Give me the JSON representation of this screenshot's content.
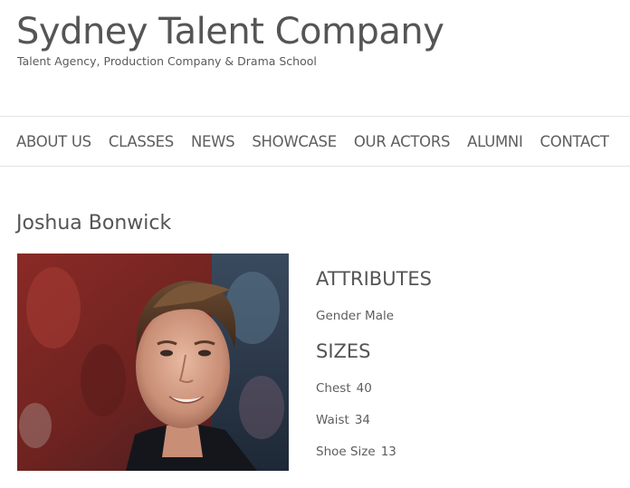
{
  "site": {
    "title": "Sydney Talent Company",
    "tagline": "Talent Agency, Production Company & Drama School"
  },
  "nav": {
    "items": [
      {
        "label": "ABOUT US"
      },
      {
        "label": "CLASSES"
      },
      {
        "label": "NEWS"
      },
      {
        "label": "SHOWCASE"
      },
      {
        "label": "OUR ACTORS"
      },
      {
        "label": "ALUMNI"
      },
      {
        "label": "CONTACT"
      }
    ]
  },
  "actor": {
    "name": "Joshua Bonwick"
  },
  "attributes": {
    "title": "ATTRIBUTES",
    "gender_label": "Gender",
    "gender_value": "Male"
  },
  "sizes": {
    "title": "SIZES",
    "chest_label": "Chest",
    "chest_value": "40",
    "waist_label": "Waist",
    "waist_value": "34",
    "shoe_label": "Shoe Size",
    "shoe_value": "13"
  },
  "colors": {
    "text": "#555555",
    "divider": "#e3e3e3",
    "background": "#ffffff"
  }
}
